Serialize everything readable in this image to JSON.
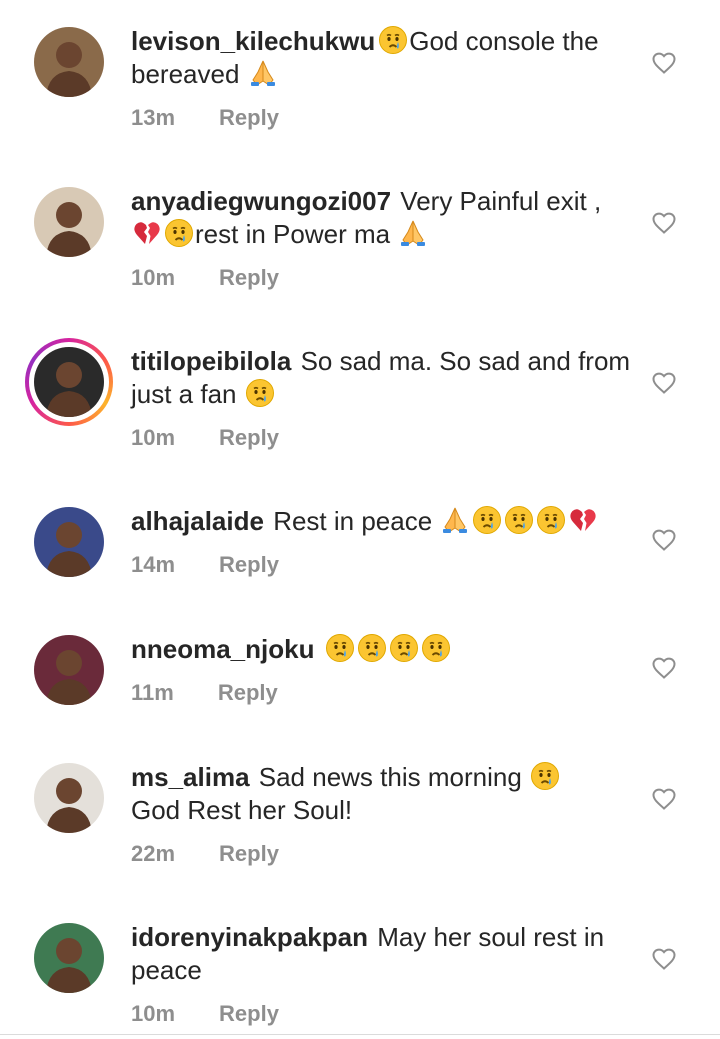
{
  "comments": [
    {
      "username": "levison_kilechukwu",
      "avatar_color": "#8a6a4a",
      "has_story": false,
      "parts": [
        {
          "t": "e",
          "v": "crying-face"
        },
        {
          "t": "s",
          "v": "God console the bereaved "
        },
        {
          "t": "e",
          "v": "folded-hands"
        }
      ],
      "time": "13m",
      "reply": "Reply"
    },
    {
      "username": "anyadiegwungozi007",
      "avatar_color": "#d8c9b5",
      "has_story": false,
      "parts": [
        {
          "t": "s",
          "v": " Very Painful exit ,"
        },
        {
          "t": "br"
        },
        {
          "t": "e",
          "v": "broken-heart"
        },
        {
          "t": "e",
          "v": "crying-face"
        },
        {
          "t": "s",
          "v": "rest in Power ma "
        },
        {
          "t": "e",
          "v": "folded-hands"
        }
      ],
      "time": "10m",
      "reply": "Reply"
    },
    {
      "username": "titilopeibilola",
      "avatar_color": "#2a2a2a",
      "has_story": true,
      "parts": [
        {
          "t": "s",
          "v": " So sad ma. So sad and from just a fan "
        },
        {
          "t": "e",
          "v": "crying-face"
        }
      ],
      "time": "10m",
      "reply": "Reply"
    },
    {
      "username": "alhajalaide",
      "avatar_color": "#3a4a8a",
      "has_story": false,
      "parts": [
        {
          "t": "s",
          "v": " Rest in peace "
        },
        {
          "t": "e",
          "v": "folded-hands"
        },
        {
          "t": "e",
          "v": "crying-face"
        },
        {
          "t": "e",
          "v": "crying-face"
        },
        {
          "t": "e",
          "v": "crying-face"
        },
        {
          "t": "e",
          "v": "broken-heart"
        }
      ],
      "time": "14m",
      "reply": "Reply"
    },
    {
      "username": "nneoma_njoku",
      "avatar_color": "#6a2a3a",
      "has_story": false,
      "parts": [
        {
          "t": "s",
          "v": " "
        },
        {
          "t": "e",
          "v": "crying-face"
        },
        {
          "t": "e",
          "v": "crying-face"
        },
        {
          "t": "e",
          "v": "crying-face"
        },
        {
          "t": "e",
          "v": "crying-face"
        }
      ],
      "time": "11m",
      "reply": "Reply"
    },
    {
      "username": "ms_alima",
      "avatar_color": "#e4e0da",
      "has_story": false,
      "parts": [
        {
          "t": "s",
          "v": " Sad news this morning "
        },
        {
          "t": "e",
          "v": "crying-face"
        },
        {
          "t": "br"
        },
        {
          "t": "s",
          "v": "God Rest her Soul!"
        }
      ],
      "time": "22m",
      "reply": "Reply"
    },
    {
      "username": "idorenyinakpakpan",
      "avatar_color": "#3f7a52",
      "has_story": false,
      "parts": [
        {
          "t": "s",
          "v": " May her soul rest in peace"
        }
      ],
      "time": "10m",
      "reply": "Reply"
    }
  ]
}
